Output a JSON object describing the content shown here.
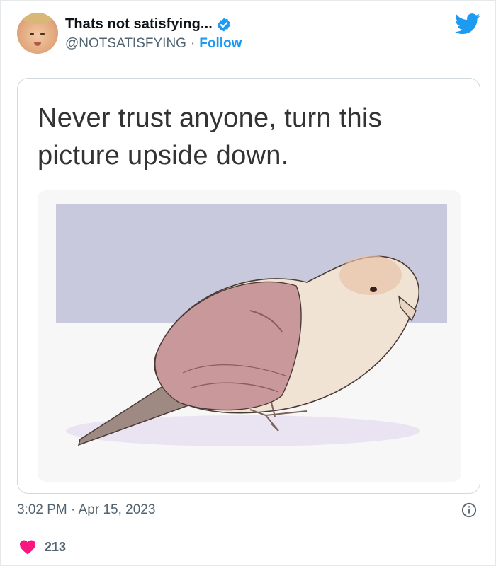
{
  "tweet": {
    "author": {
      "display_name": "Thats not satisfying...",
      "handle": "@NOTSATISFYING",
      "separator": "·",
      "follow_label": "Follow",
      "verified": true,
      "avatar_icon": "toddler-face-avatar"
    },
    "brand_icon": "twitter-bird-icon",
    "media": {
      "caption_line1": "Never trust anyone, turn this",
      "caption_line2": "picture upside down.",
      "image_subject": "bird-illustration"
    },
    "timestamp": "3:02 PM · Apr 15, 2023",
    "info_icon": "info-icon",
    "likes": {
      "icon": "heart-icon",
      "count": "213"
    }
  },
  "colors": {
    "accent": "#1d9bf0",
    "heart": "#f91880",
    "secondary_text": "#536471",
    "border": "#cfd9de"
  }
}
